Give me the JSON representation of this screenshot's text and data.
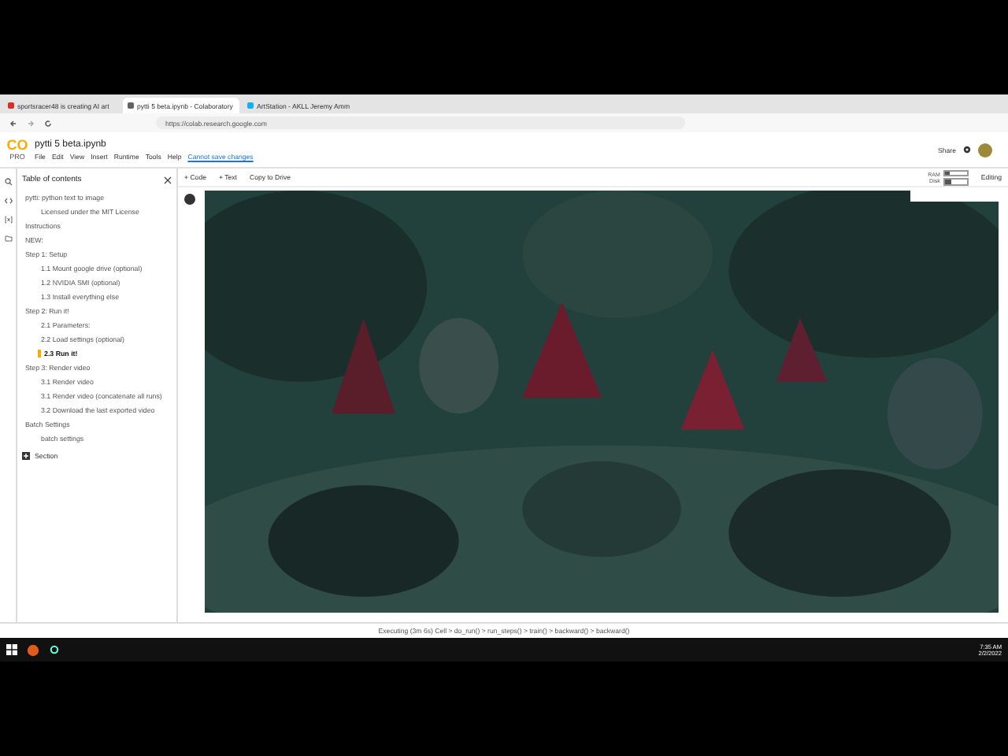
{
  "browser_tabs": [
    {
      "title": "sportsracer48 is creating AI art",
      "selected": false
    },
    {
      "title": "pytti 5 beta.ipynb - Colaboratory",
      "selected": true
    },
    {
      "title": "ArtStation - AKLL Jeremy Amm",
      "selected": false
    }
  ],
  "address": "https://colab.research.google.com",
  "notebook": {
    "logo": "CO",
    "plan": "PRO",
    "title": "pytti 5 beta.ipynb",
    "menu": [
      "File",
      "Edit",
      "View",
      "Insert",
      "Runtime",
      "Tools",
      "Help"
    ],
    "save_notice": "Cannot save changes",
    "share": "Share"
  },
  "toolbar": {
    "buttons": [
      "+ Code",
      "+ Text",
      "Copy to Drive"
    ],
    "ram": {
      "label": "RAM",
      "level": 0.25
    },
    "disk": {
      "label": "Disk",
      "level": 0.3
    },
    "mode": "Editing"
  },
  "toc": {
    "title": "Table of contents",
    "items": [
      {
        "label": "pytti: python text to image",
        "selected": false,
        "children": [
          {
            "label": "Licensed under the MIT License",
            "selected": false
          }
        ]
      },
      {
        "label": "Instructions",
        "selected": false
      },
      {
        "label": "NEW:",
        "selected": false
      },
      {
        "label": "Step 1: Setup",
        "selected": false,
        "children": [
          {
            "label": "1.1 Mount google drive (optional)",
            "selected": false
          },
          {
            "label": "1.2 NVIDIA SMI (optional)",
            "selected": false
          },
          {
            "label": "1.3 Install everything else",
            "selected": false
          }
        ]
      },
      {
        "label": "Step 2: Run it!",
        "selected": false,
        "children": [
          {
            "label": "2.1 Parameters:",
            "selected": false
          },
          {
            "label": "2.2 Load settings (optional)",
            "selected": false
          },
          {
            "label": "2.3 Run it!",
            "selected": true
          }
        ]
      },
      {
        "label": "Step 3: Render video",
        "selected": false,
        "children": [
          {
            "label": "3.1 Render video",
            "selected": false
          },
          {
            "label": "3.1 Render video (concatenate all runs)",
            "selected": false
          },
          {
            "label": "3.2 Download the last exported video",
            "selected": false
          }
        ]
      },
      {
        "label": "Batch Settings",
        "selected": false,
        "children": [
          {
            "label": "batch settings",
            "selected": false
          }
        ]
      }
    ],
    "section_button": "Section"
  },
  "status": "Executing (3m 6s) Cell > do_run() > run_steps() > train() > backward() > backward()",
  "taskbar": {
    "time": "7:35 AM",
    "date": "2/2/2022"
  }
}
